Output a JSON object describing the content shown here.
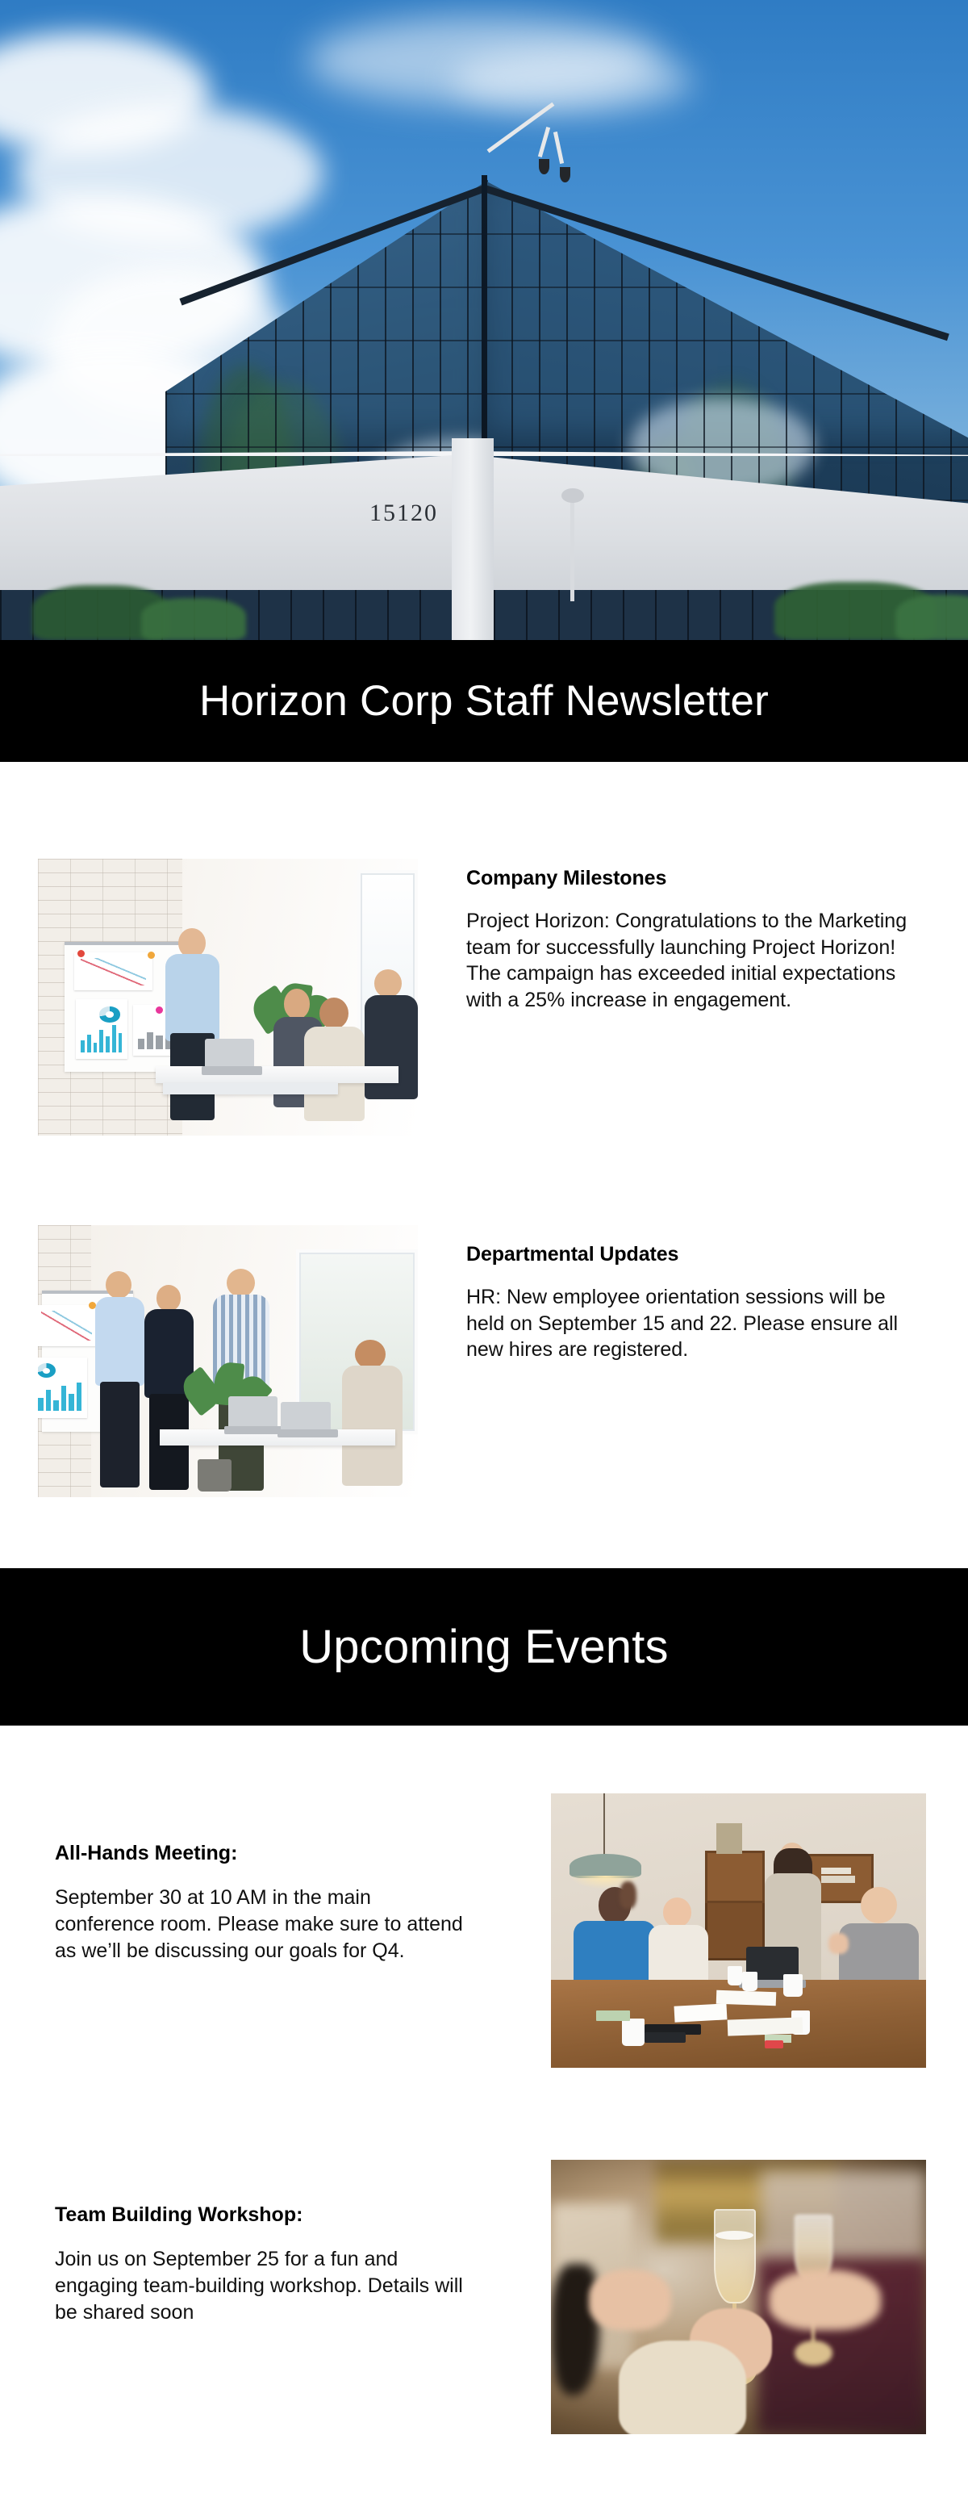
{
  "hero": {
    "image_name": "glass-office-building-exterior-photo",
    "building_number": "15120",
    "alt": "Modern glass-facade corporate office building against a blue sky with clouds"
  },
  "title_banner": {
    "title": "Horizon Corp Staff Newsletter",
    "background_color": "#000000",
    "text_color": "#ffffff"
  },
  "articles": [
    {
      "id": "company-milestones",
      "title": "Company Milestones",
      "body": "Project Horizon: Congratulations to the Marketing team for successfully launching Project Horizon! The campaign has exceeded initial expectations with a 25% increase in engagement.",
      "image_name": "team-presentation-flipchart-photo",
      "image_alt": "Colleagues in a bright office reviewing charts on a flipchart during a presentation"
    },
    {
      "id": "departmental-updates",
      "title": "Departmental Updates",
      "body": "HR: New employee orientation sessions will be held on September 15 and 22. Please ensure all new hires are registered.",
      "image_name": "team-standing-discussion-photo",
      "image_alt": "Four colleagues standing around a desk with laptops discussing work"
    }
  ],
  "events_banner": {
    "title": "Upcoming Events",
    "background_color": "#000000",
    "text_color": "#ffffff"
  },
  "events": [
    {
      "id": "all-hands-meeting",
      "title": "All-Hands Meeting:",
      "body": "September 30 at 10 AM in the main conference room. Please make sure to attend as we’ll be discussing our goals for Q4.",
      "image_name": "team-high-five-meeting-photo",
      "image_alt": "Team members around a conference table giving a high five while a colleague presents"
    },
    {
      "id": "team-building-workshop",
      "title": "Team Building Workshop:",
      "body": "Join us on September 25 for a fun and engaging team-building workshop. Details will be shared soon",
      "image_name": "champagne-toast-celebration-photo",
      "image_alt": "Close-up of two people holding champagne flutes in a celebratory toast"
    }
  ],
  "theme": {
    "page_background": "#ffffff",
    "banner_background": "#000000",
    "banner_text": "#ffffff",
    "heading_color": "#000000",
    "body_text_color": "#111111"
  }
}
